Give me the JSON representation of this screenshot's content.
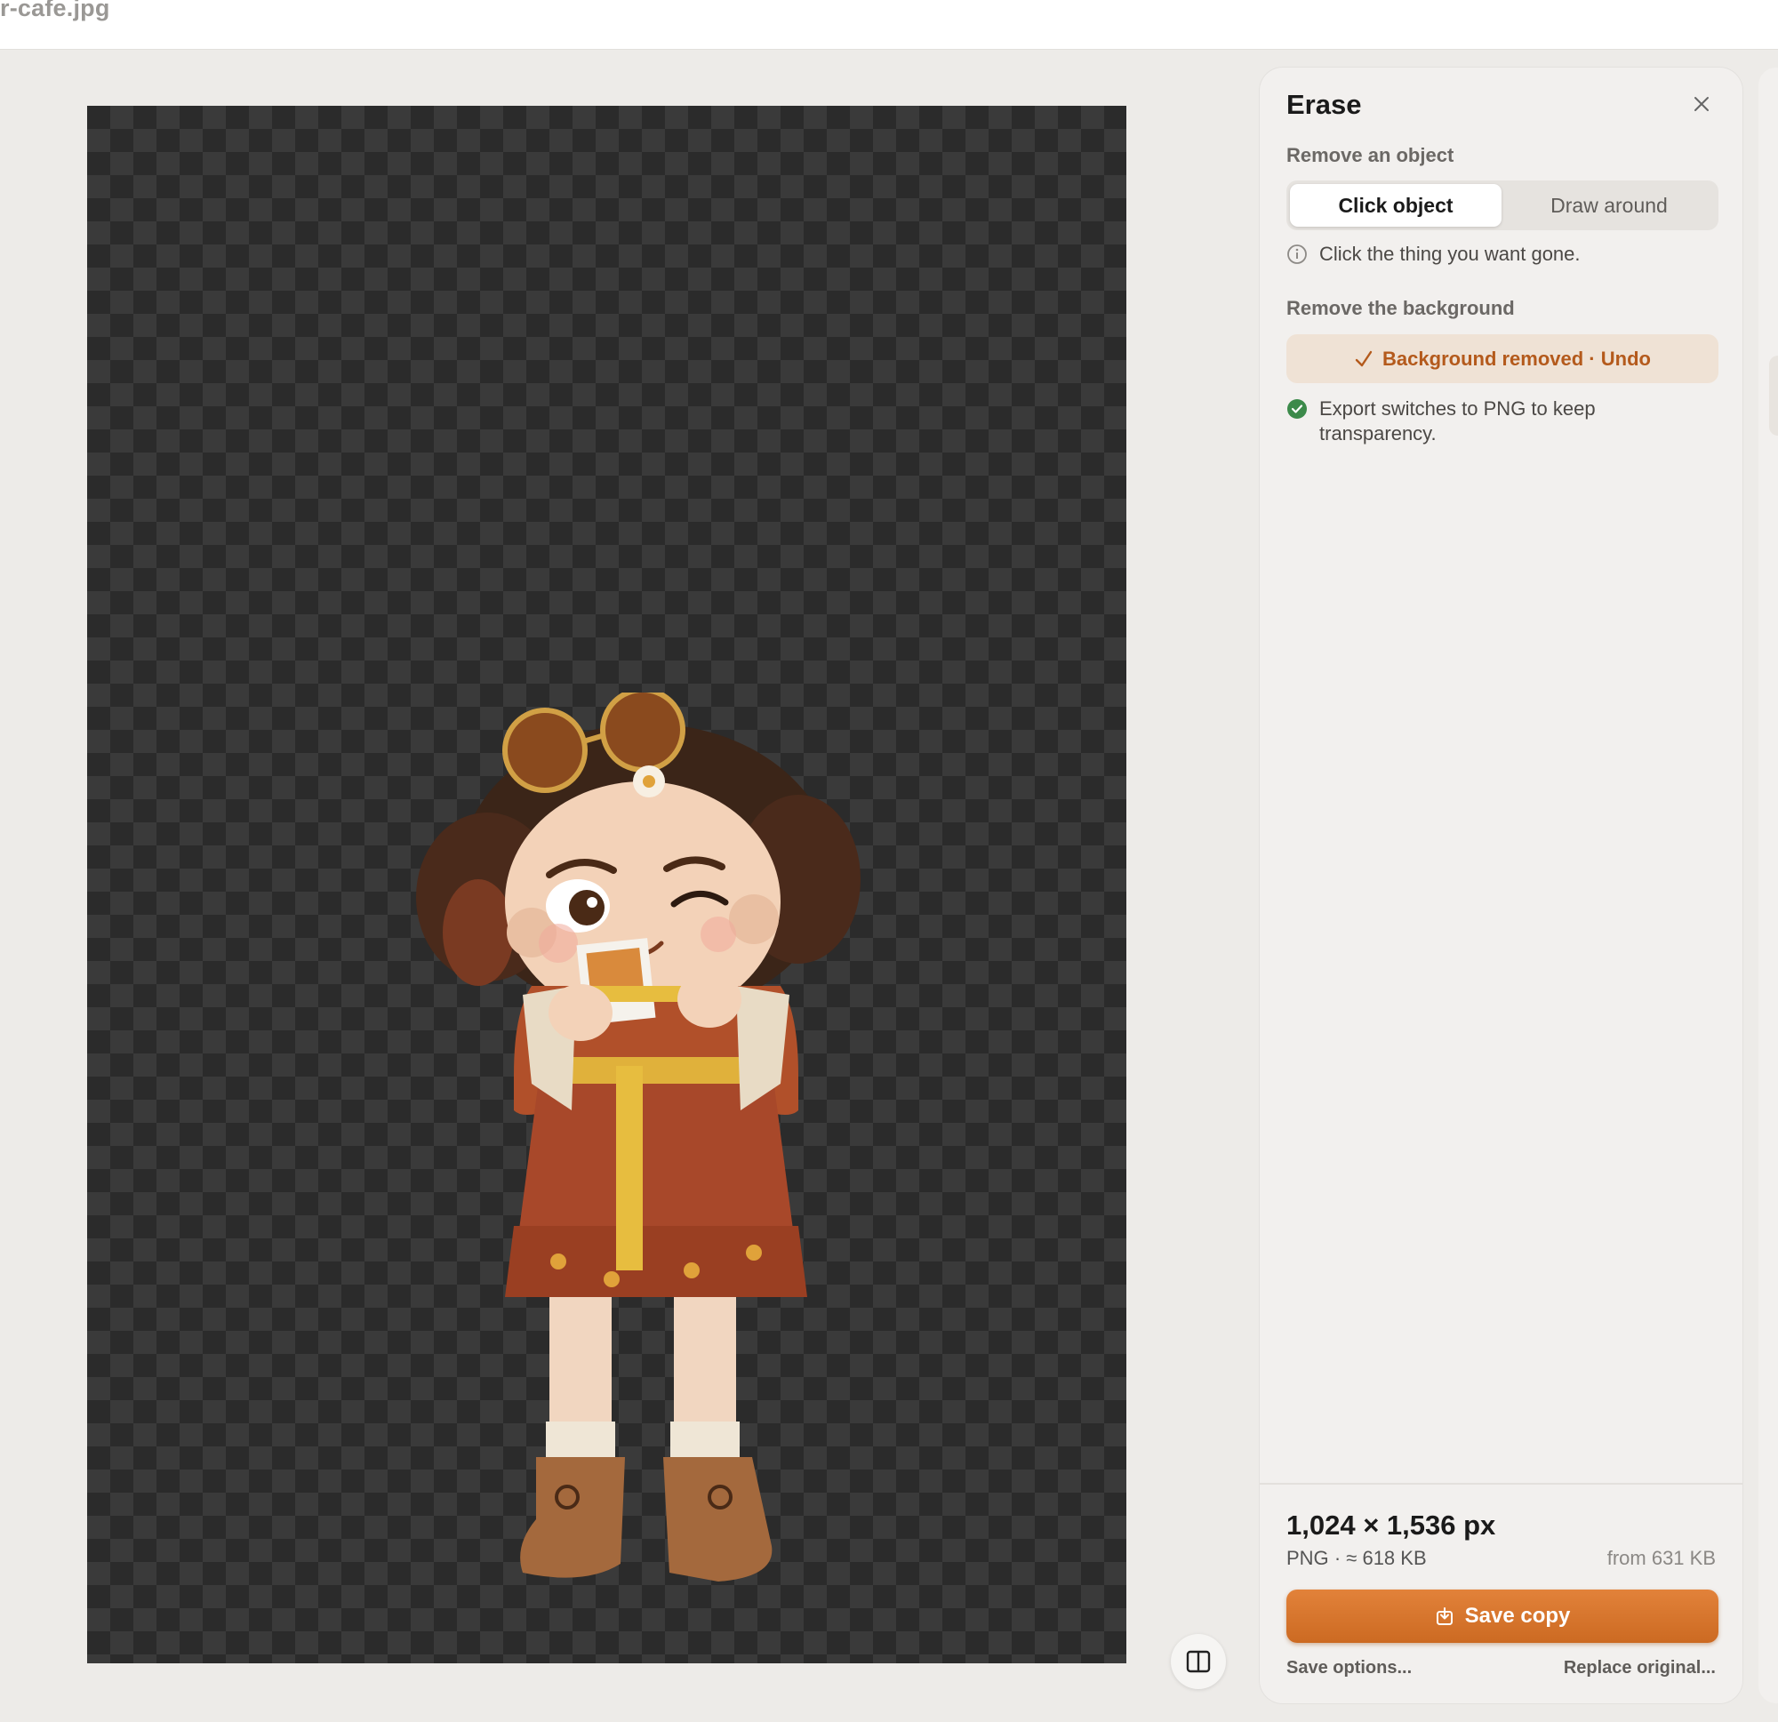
{
  "window": {
    "filename": "r-cafe.jpg"
  },
  "canvas": {
    "background": "transparent-checkerboard",
    "image_subject": "felt doll girl with sunglasses, measuring tape and photo"
  },
  "compare_button": {
    "icon": "split-view-icon"
  },
  "panel": {
    "title": "Erase",
    "close_icon": "close-icon",
    "remove_object": {
      "label": "Remove an object",
      "options": [
        "Click object",
        "Draw around"
      ],
      "selected": "Click object",
      "hint": "Click the thing you want gone."
    },
    "remove_background": {
      "label": "Remove the background",
      "status_label": "Background removed · Undo",
      "note": "Export switches to PNG to keep transparency."
    },
    "output": {
      "dimensions": "1,024 × 1,536 px",
      "format": "PNG",
      "size": "≈ 618 KB",
      "from": "from 631 KB",
      "save_label": "Save copy",
      "save_options": "Save options...",
      "replace_original": "Replace original..."
    }
  },
  "colors": {
    "accent": "#d8762e",
    "success": "#3c8a4a",
    "panel": "#f2f0ee"
  }
}
